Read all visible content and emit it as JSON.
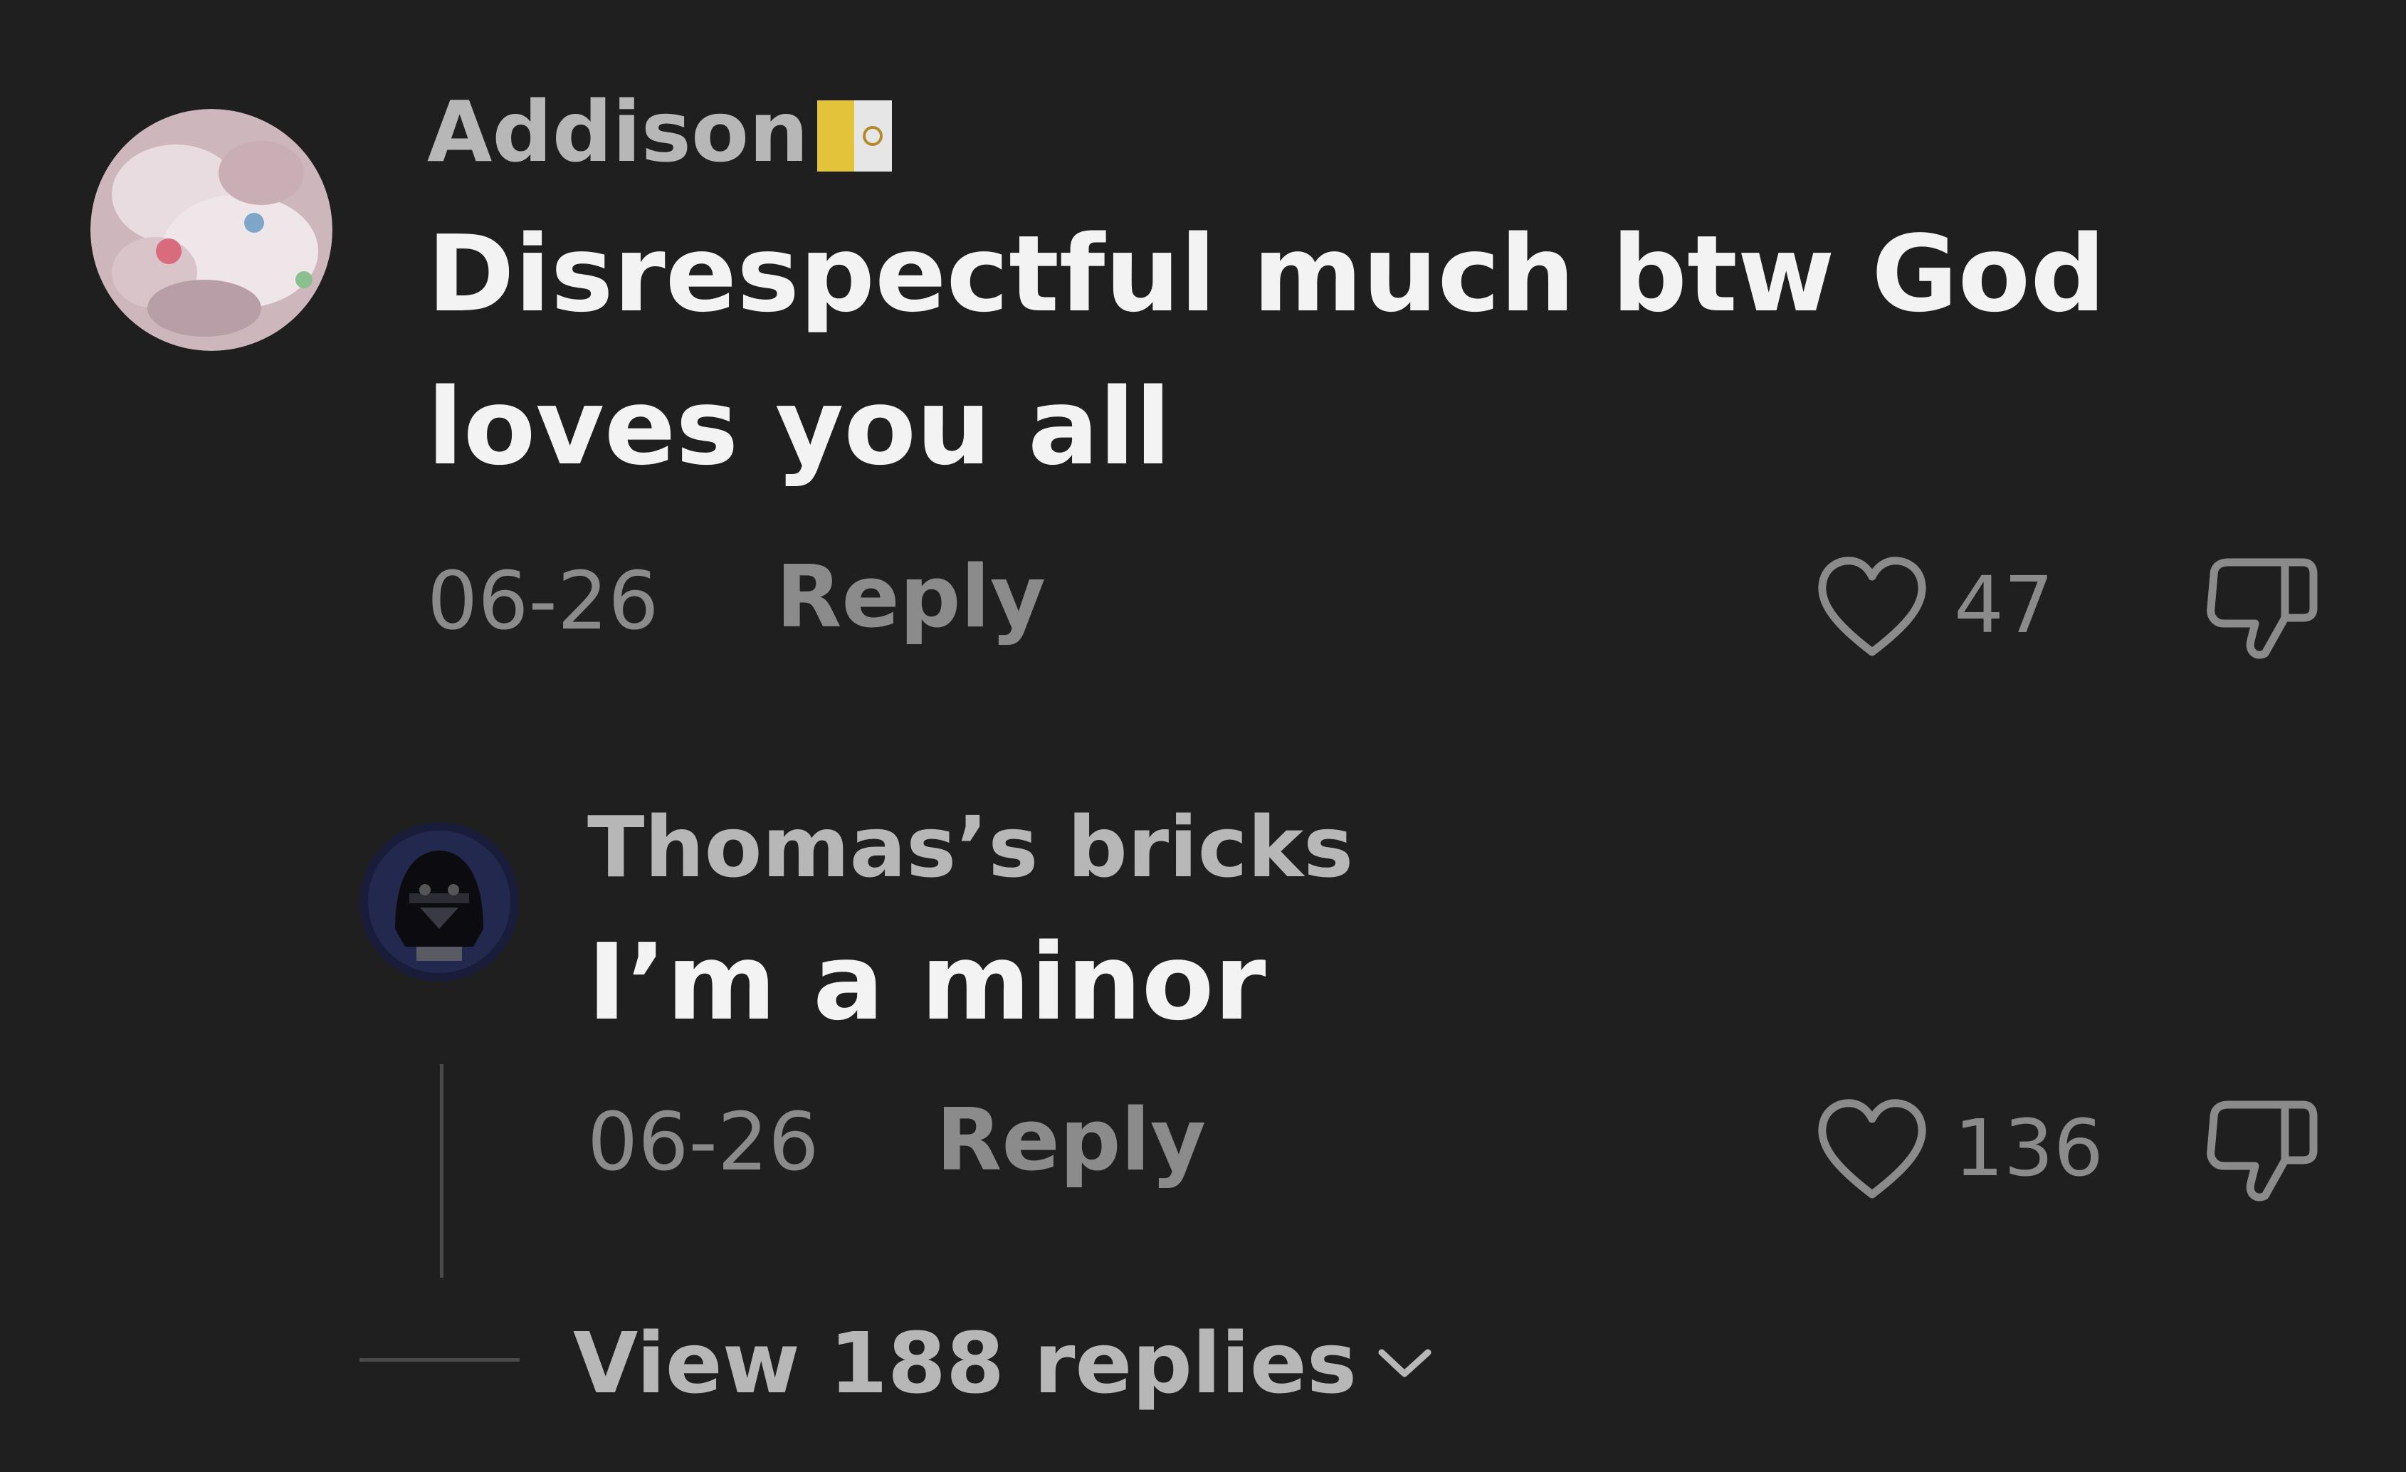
{
  "comments": [
    {
      "username": "Addison",
      "flag_icon": "vatican-flag-icon",
      "text_line1": "Disrespectful much btw God",
      "text_line2": "loves you all",
      "date": "06-26",
      "reply_label": "Reply",
      "likes": "47"
    }
  ],
  "reply": {
    "username": "Thomas’s bricks",
    "text": "I’m a minor",
    "date": "06-26",
    "reply_label": "Reply",
    "likes": "136"
  },
  "view_replies": {
    "label": "View 188 replies"
  },
  "colors": {
    "background": "#1f1f1f",
    "username": "#b7b7b7",
    "body_text": "#f3f3f3",
    "meta_text": "#8b8b8b",
    "divider": "#4a4a4a"
  }
}
